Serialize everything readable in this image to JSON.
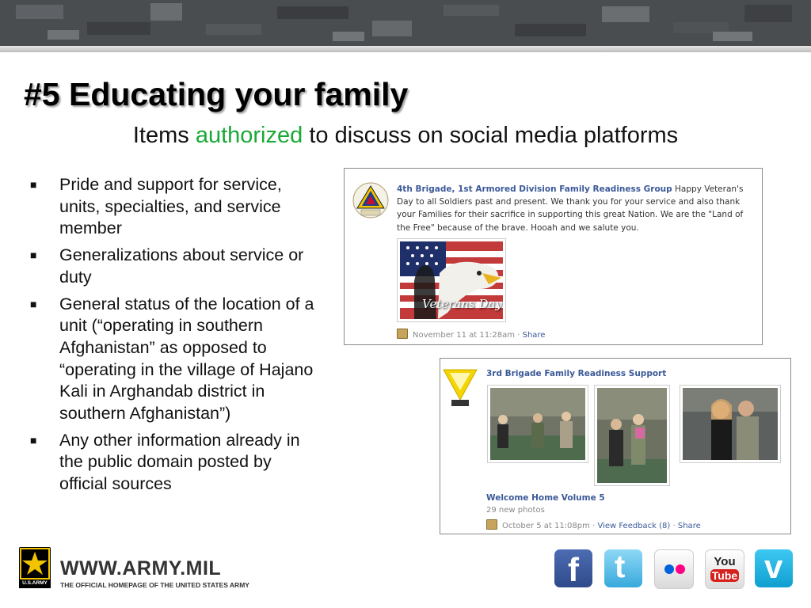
{
  "slide": {
    "title": "#5 Educating your family",
    "subtitle": {
      "before": "Items",
      "highlight": "authorized",
      "after": "to discuss on social media platforms",
      "highlight_color": "#19a935"
    }
  },
  "bullets": [
    {
      "text": "Pride and support for service, units, specialties, and service member"
    },
    {
      "text": "Generalizations about service or duty"
    },
    {
      "text": "General status of the location of a unit (“operating in southern Afghanistan” as opposed to “operating in the village of Hajano Kali in Arghandab district in southern Afghanistan”)"
    },
    {
      "text": "Any other information already in the public domain posted by official sources"
    }
  ],
  "post1": {
    "page_name": "4th Brigade, 1st Armored Division Family Readiness Group",
    "message": "Happy Veteran's Day to all Soldiers past and present. We thank you for your service and also thank your Families for their sacrifice in supporting this great Nation. We are the \"Land of the Free\" because of the brave. Hooah and we salute you.",
    "image_caption": "Veterans Day",
    "timestamp": "November 11 at 11:28am",
    "separator": "·",
    "share_label": "Share"
  },
  "post2": {
    "page_name": "3rd Brigade Family Readiness Support",
    "album_title": "Welcome Home Volume 5",
    "photo_count": "29 new photos",
    "timestamp": "October 5 at 11:08pm",
    "separator": "·",
    "feedback_label": "View Feedback (8)",
    "share_label": "Share"
  },
  "footer": {
    "logo_text": "U.S.ARMY",
    "url": "WWW.ARMY.MIL",
    "tagline": "THE OFFICIAL HOMEPAGE OF THE UNITED STATES ARMY",
    "social": [
      {
        "icon": "facebook-icon",
        "glyph": "f",
        "color": "#3b5998"
      },
      {
        "icon": "twitter-icon",
        "glyph": "t",
        "color": "#5fc3f0"
      },
      {
        "icon": "flickr-icon",
        "glyph": "••",
        "color": "#e6e6e6"
      },
      {
        "icon": "youtube-icon",
        "glyph_top": "You",
        "glyph_bottom": "Tube",
        "color": "#f1f1f1"
      },
      {
        "icon": "vimeo-icon",
        "glyph": "v",
        "color": "#1ab7ea"
      }
    ]
  }
}
